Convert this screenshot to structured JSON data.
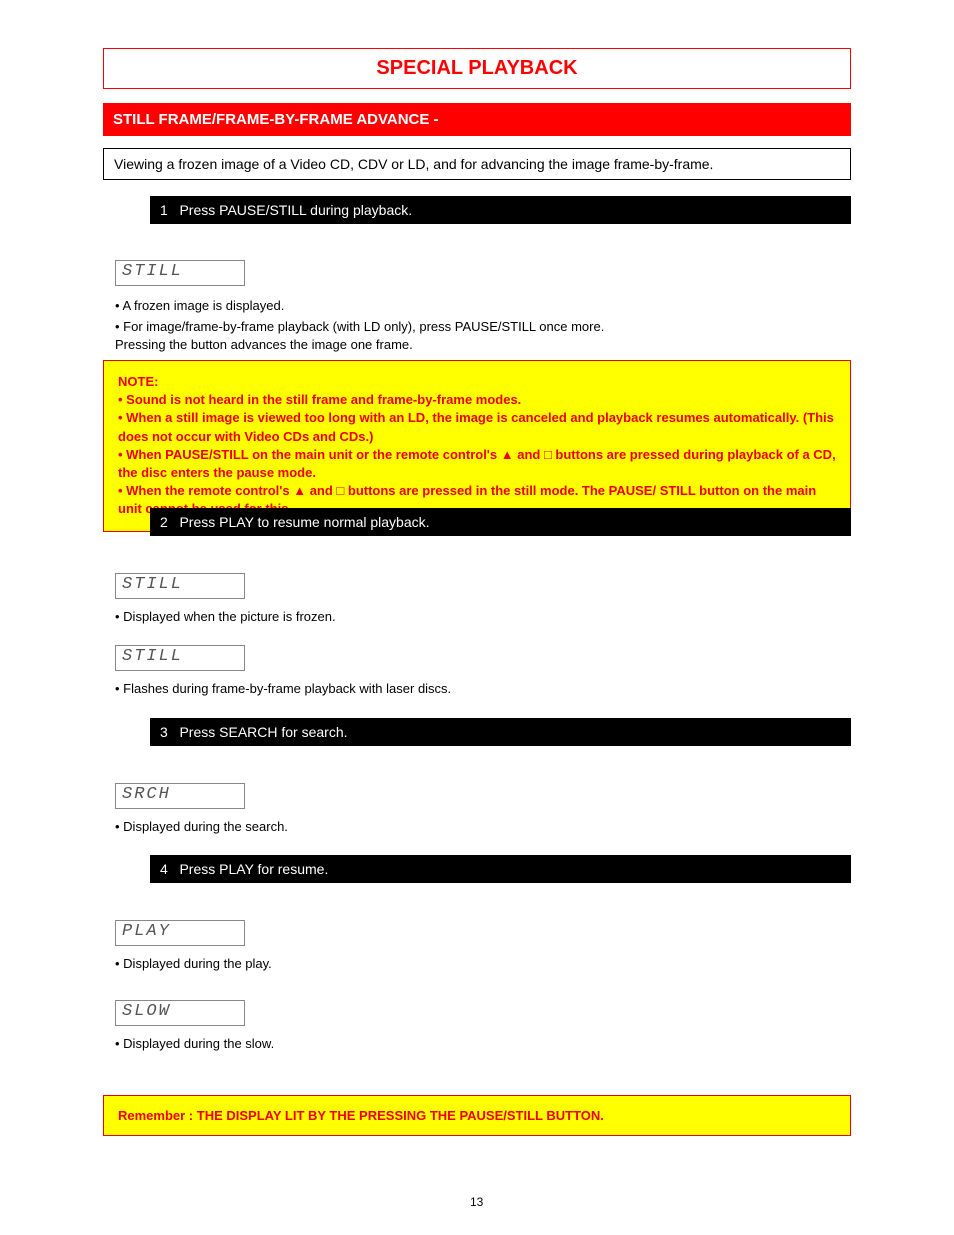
{
  "title": "SPECIAL PLAYBACK",
  "heading": "STILL FRAME/FRAME-BY-FRAME ADVANCE -",
  "subheading": "Viewing a frozen image of a Video CD, CDV or LD, and for advancing the image frame-by-frame.",
  "step1": {
    "label": "1",
    "text": "Press PAUSE/STILL during playback."
  },
  "lcd_still_a": "STILL",
  "para1": "• A frozen image is displayed.",
  "para2a": "• For image/frame-by-frame playback (with LD only), press PAUSE/STILL once more.",
  "para2b": "Pressing the button advances the image one frame.",
  "note1": {
    "label": "NOTE:",
    "lines": [
      "• Sound is not heard in the still frame and frame-by-frame modes.",
      "• When a still image is viewed too long with an LD, the image is canceled and playback resumes automatically. (This does not occur with Video CDs and CDs.)",
      "• When PAUSE/STILL on the main unit or the remote control's ▲ and □ buttons are pressed during playback of a CD, the disc enters the pause mode.",
      "• When the remote control's ▲ and □ buttons are pressed in the still mode. The PAUSE/ STILL button on the main unit cannot be used for this."
    ]
  },
  "step2": {
    "label": "2",
    "text": "Press PLAY to resume normal playback."
  },
  "lcd_still_b": "STILL",
  "para3": "• Displayed when the picture is frozen.",
  "lcd_still_c": "STILL",
  "para4": "• Flashes during frame-by-frame playback with laser discs.",
  "step3": {
    "label": "3",
    "text": "Press SEARCH for search."
  },
  "lcd_srch": "SRCH",
  "para5": "• Displayed during the search.",
  "step4": {
    "label": "4",
    "text": "Press PLAY for resume."
  },
  "lcd_play": "PLAY",
  "para6": "• Displayed during the play.",
  "lcd_slow": "SLOW",
  "para7": "• Displayed during the slow.",
  "footnote": "Remember : THE DISPLAY LIT BY THE PRESSING THE PAUSE/STILL BUTTON.",
  "page": "13"
}
